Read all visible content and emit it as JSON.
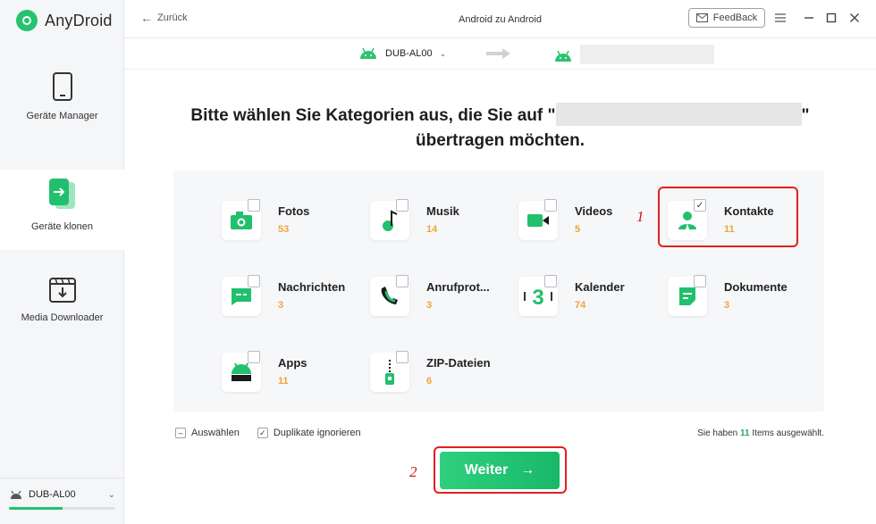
{
  "app": {
    "name": "AnyDroid"
  },
  "sidebar": {
    "items": [
      {
        "label": "Geräte Manager",
        "icon": "phone-icon",
        "active": false
      },
      {
        "label": "Geräte klonen",
        "icon": "clone-icon",
        "active": true
      },
      {
        "label": "Media Downloader",
        "icon": "download-icon",
        "active": false
      }
    ],
    "device": {
      "name": "DUB-AL00",
      "storage_used_fraction": 0.5
    }
  },
  "topbar": {
    "back_label": "Zurück",
    "title": "Android zu Android",
    "feedback_label": "FeedBack"
  },
  "devicebar": {
    "source_name": "DUB-AL00"
  },
  "heading": {
    "line1_prefix": "Bitte wählen Sie Kategorien aus, die Sie auf \"",
    "line1_suffix": "\"",
    "line2": "übertragen möchten."
  },
  "categories": [
    {
      "name": "Fotos",
      "count": "53",
      "checked": false,
      "icon": "photo-icon"
    },
    {
      "name": "Musik",
      "count": "14",
      "checked": false,
      "icon": "music-icon"
    },
    {
      "name": "Videos",
      "count": "5",
      "checked": false,
      "icon": "video-icon"
    },
    {
      "name": "Kontakte",
      "count": "11",
      "checked": true,
      "icon": "contact-icon"
    },
    {
      "name": "Nachrichten",
      "count": "3",
      "checked": false,
      "icon": "message-icon"
    },
    {
      "name": "Anrufprot...",
      "count": "3",
      "checked": false,
      "icon": "call-log-icon"
    },
    {
      "name": "Kalender",
      "count": "74",
      "checked": false,
      "icon": "calendar-icon"
    },
    {
      "name": "Dokumente",
      "count": "3",
      "checked": false,
      "icon": "document-icon"
    },
    {
      "name": "Apps",
      "count": "11",
      "checked": false,
      "icon": "android-icon"
    },
    {
      "name": "ZIP-Dateien",
      "count": "6",
      "checked": false,
      "icon": "zip-icon"
    }
  ],
  "options": {
    "select_all_label": "Auswählen",
    "ignore_duplicates_label": "Duplikate ignorieren"
  },
  "summary": {
    "prefix": "Sie haben",
    "count": "11",
    "suffix": "Items ausgewählt."
  },
  "next_button": {
    "label": "Weiter"
  },
  "annotations": {
    "step1": "1",
    "step2": "2"
  },
  "colors": {
    "accent": "#25c26f",
    "count": "#f0a43a",
    "highlight": "#e02020"
  }
}
